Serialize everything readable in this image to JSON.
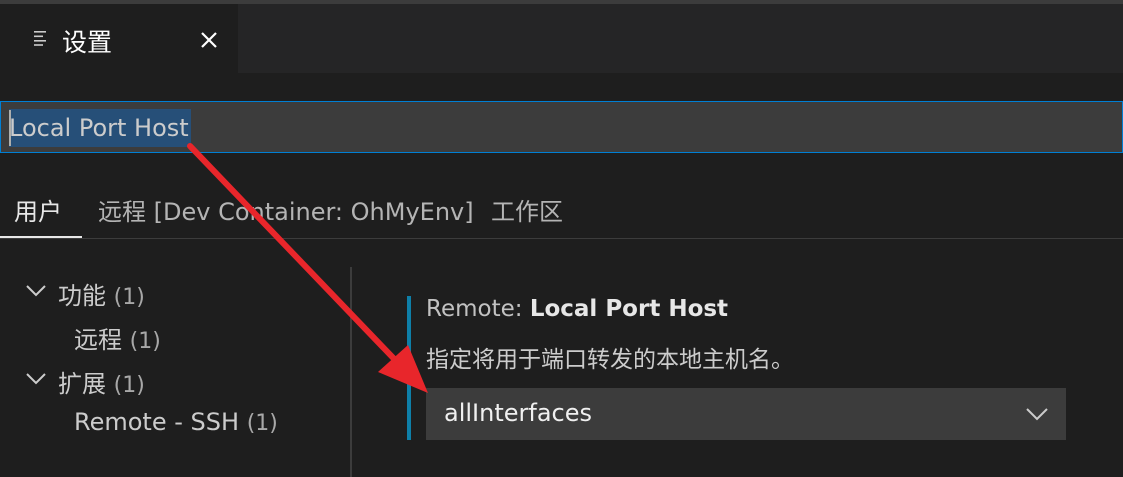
{
  "editor_tab": {
    "title": "设置",
    "icon": "settings-list-icon",
    "close_icon": "close-icon"
  },
  "search": {
    "value": "Local Port Host"
  },
  "scope_tabs": [
    {
      "label": "用户",
      "active": true
    },
    {
      "label": "远程 [Dev Container: OhMyEnv]",
      "active": false
    },
    {
      "label": "工作区",
      "active": false
    }
  ],
  "toc": {
    "items": [
      {
        "label": "功能",
        "count": "(1)",
        "expanded": true
      },
      {
        "label": "远程",
        "count": "(1)"
      },
      {
        "label": "扩展",
        "count": "(1)",
        "expanded": true
      },
      {
        "label": "Remote - SSH",
        "count": "(1)"
      }
    ]
  },
  "setting": {
    "category": "Remote: ",
    "name": "Local Port Host",
    "description": "指定将用于端口转发的本地主机名。",
    "value": "allInterfaces"
  },
  "colors": {
    "accent": "#007fd4",
    "annotation_arrow": "#e8262b",
    "modified_bar": "#0e7fa8"
  }
}
